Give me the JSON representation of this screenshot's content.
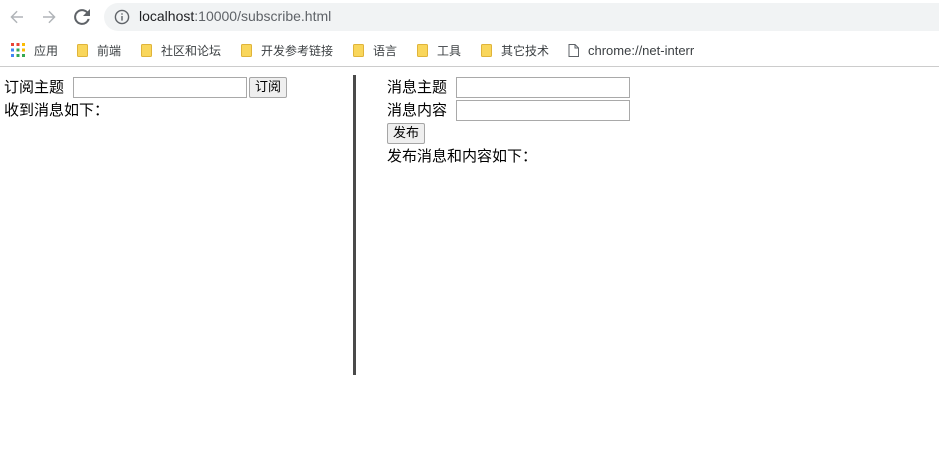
{
  "browser": {
    "url_host": "localhost",
    "url_path": ":10000/subscribe.html",
    "nav_icons": [
      "back-arrow-icon",
      "forward-arrow-icon",
      "reload-icon",
      "info-icon"
    ]
  },
  "bookmarks": {
    "items": [
      {
        "label": "应用",
        "icon": "apps-grid-icon"
      },
      {
        "label": "前端",
        "icon": "folder-icon"
      },
      {
        "label": "社区和论坛",
        "icon": "folder-icon"
      },
      {
        "label": "开发参考链接",
        "icon": "folder-icon"
      },
      {
        "label": "语言",
        "icon": "folder-icon"
      },
      {
        "label": "工具",
        "icon": "folder-icon"
      },
      {
        "label": "其它技术",
        "icon": "folder-icon"
      },
      {
        "label": "chrome://net-interr",
        "icon": "page-icon"
      }
    ],
    "folder_color": "#f9d65b"
  },
  "subscribe": {
    "topic_label": "订阅主题",
    "topic_value": "",
    "subscribe_button": "订阅",
    "received_label": "收到消息如下："
  },
  "publish": {
    "topic_label": "消息主题",
    "topic_value": "",
    "content_label": "消息内容",
    "content_value": "",
    "publish_button": "发布",
    "published_label": "发布消息和内容如下："
  },
  "colors": {
    "divider": "#4a4a4a",
    "omnibox_bg": "#f1f3f4"
  }
}
